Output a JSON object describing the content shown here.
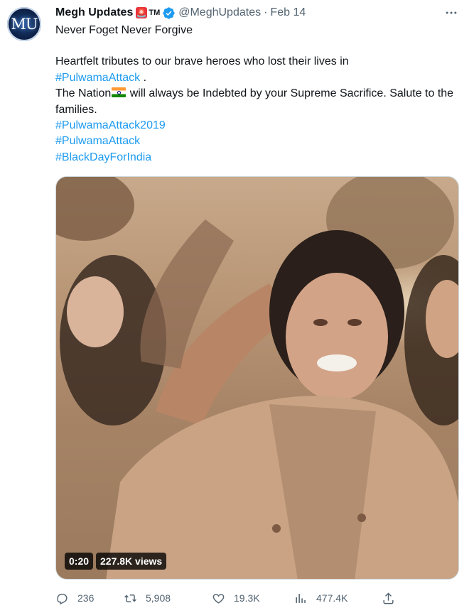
{
  "author": {
    "avatar_text": "MU",
    "name": "Megh Updates",
    "name_badge_emoji": "🚨",
    "tm_mark": "TM",
    "handle": "@MeghUpdates",
    "separator": "·",
    "date": "Feb 14"
  },
  "tweet": {
    "line1": "Never Foget Never Forgive",
    "para2_line1": "Heartfelt tributes to our brave heroes who lost their lives in",
    "hashtag_pulwama_1": "#PulwamaAttack",
    "period": " .",
    "nation_prefix": "The Nation",
    "nation_suffix": " will always be Indebted by your Supreme Sacrifice. Salute to the families.",
    "hashtag_pulwama_2019": "#PulwamaAttack2019",
    "hashtag_pulwama_2": "#PulwamaAttack",
    "hashtag_blackday": "#BlackDayForIndia"
  },
  "media": {
    "type": "video",
    "duration": "0:20",
    "views": "227.8K views"
  },
  "actions": {
    "replies": "236",
    "retweets": "5,908",
    "likes": "19.3K",
    "views": "477.4K"
  },
  "icons": {
    "verified": "verified-badge-icon",
    "more": "more-horizontal-icon",
    "reply": "reply-icon",
    "retweet": "retweet-icon",
    "like": "heart-icon",
    "views": "analytics-icon",
    "share": "share-icon"
  },
  "colors": {
    "link": "#1d9bf0",
    "muted": "#536471",
    "text": "#0f1419",
    "verified": "#1d9bf0"
  }
}
